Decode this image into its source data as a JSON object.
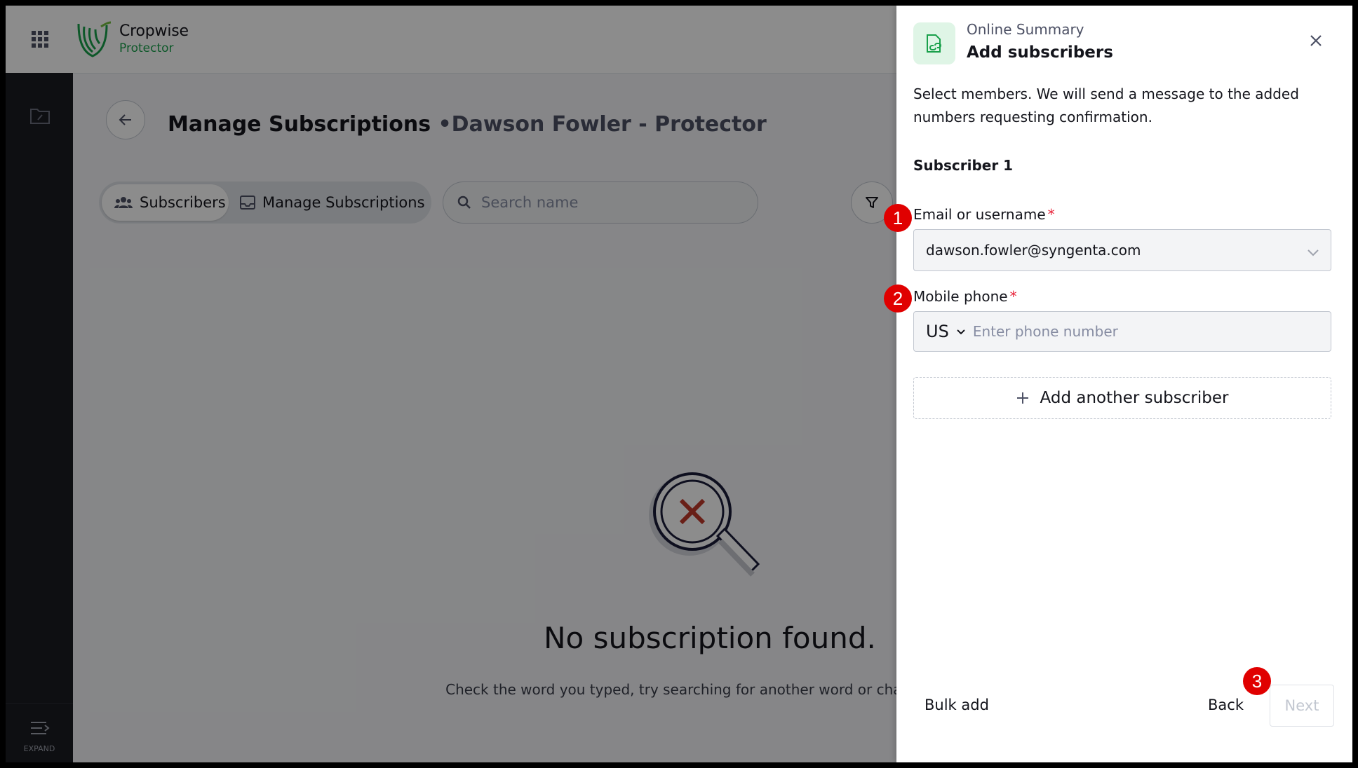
{
  "app": {
    "name": "Cropwise",
    "product": "Protector"
  },
  "sidebar": {
    "expand_label": "EXPAND"
  },
  "page": {
    "title": "Manage Subscriptions",
    "subtitle": "•Dawson Fowler - Protector",
    "tabs": [
      {
        "label": "Subscribers",
        "active": true
      },
      {
        "label": "Manage Subscriptions",
        "active": false
      }
    ],
    "search_placeholder": "Search name",
    "empty_title": "No subscription found.",
    "empty_description": "Check the word you typed, try searching for another word or change filters."
  },
  "drawer": {
    "kicker": "Online Summary",
    "title": "Add subscribers",
    "intro": "Select members. We will send a message to the added numbers requesting confirmation.",
    "subscriber_heading": "Subscriber 1",
    "email_label": "Email or username",
    "email_value": "dawson.fowler@syngenta.com",
    "phone_label": "Mobile phone",
    "country_code": "US",
    "phone_placeholder": "Enter phone number",
    "required_mark": "*",
    "add_another_label": "Add another subscriber",
    "bulk_add_label": "Bulk add",
    "back_label": "Back",
    "next_label": "Next"
  },
  "markers": [
    "1",
    "2",
    "3"
  ],
  "colors": {
    "brand_green": "#19a04b",
    "required_red": "#e8253b",
    "marker_red": "#e00000",
    "sidebar_bg": "#1b1c22"
  }
}
